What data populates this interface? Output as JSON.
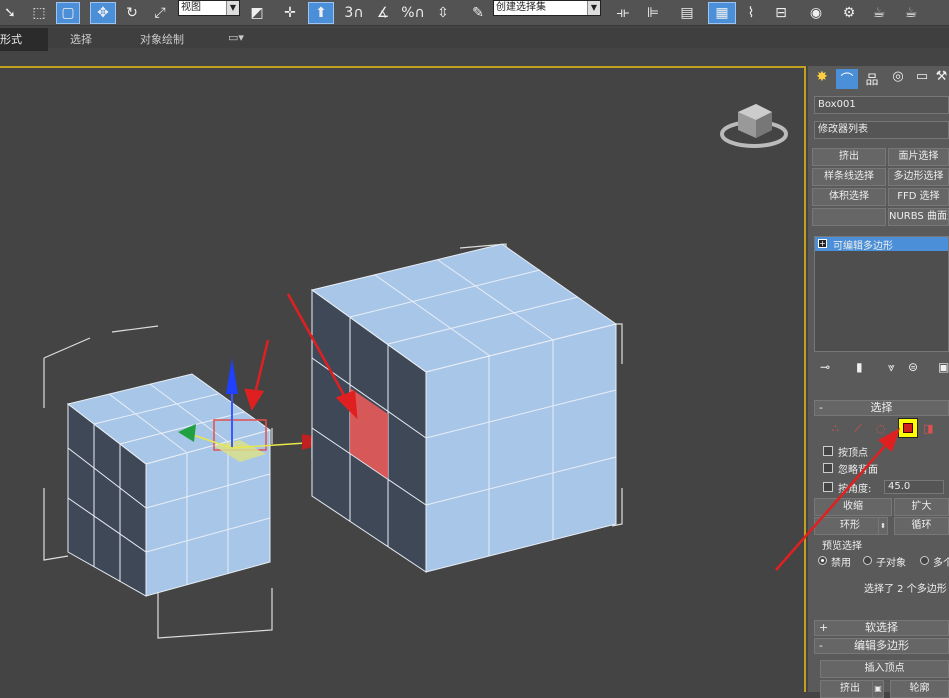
{
  "toolbar": {
    "view_select": "视图",
    "selection_set": "创建选择集",
    "snap_angle": "3",
    "percent": "%"
  },
  "ribbon": {
    "tabs": [
      "形式",
      "选择",
      "对象绘制"
    ]
  },
  "command_panel": {
    "object_name": "Box001",
    "modifier_list": "修改器列表",
    "modifier_buttons": [
      "挤出",
      "面片选择",
      "样条线选择",
      "多边形选择",
      "体积选择",
      "FFD 选择",
      "",
      "NURBS 曲面选"
    ],
    "stack_item": "可编辑多边形",
    "selection_rollout": {
      "title": "选择",
      "by_vertex": "按顶点",
      "ignore_backfacing": "忽略背面",
      "by_angle": "按角度:",
      "angle_value": "45.0",
      "shrink": "收缩",
      "grow": "扩大",
      "ring": "环形",
      "loop": "循环",
      "preview_group": "预览选择",
      "preview_options": [
        "禁用",
        "子对象",
        "多个"
      ],
      "status": "选择了 2 个多边形"
    },
    "soft_selection": "软选择",
    "edit_polygons": "编辑多边形",
    "insert_vertex": "插入顶点",
    "bottom_buttons": [
      "挤出",
      "轮廓"
    ]
  },
  "colors": {
    "accent_blue": "#4a8fd8",
    "selected_poly": "#e85a5a",
    "highlight_yellow": "#ffff00",
    "viewport_border": "#c3a020",
    "cube_face": "#a8c6e8",
    "cube_side": "#3f4856"
  }
}
